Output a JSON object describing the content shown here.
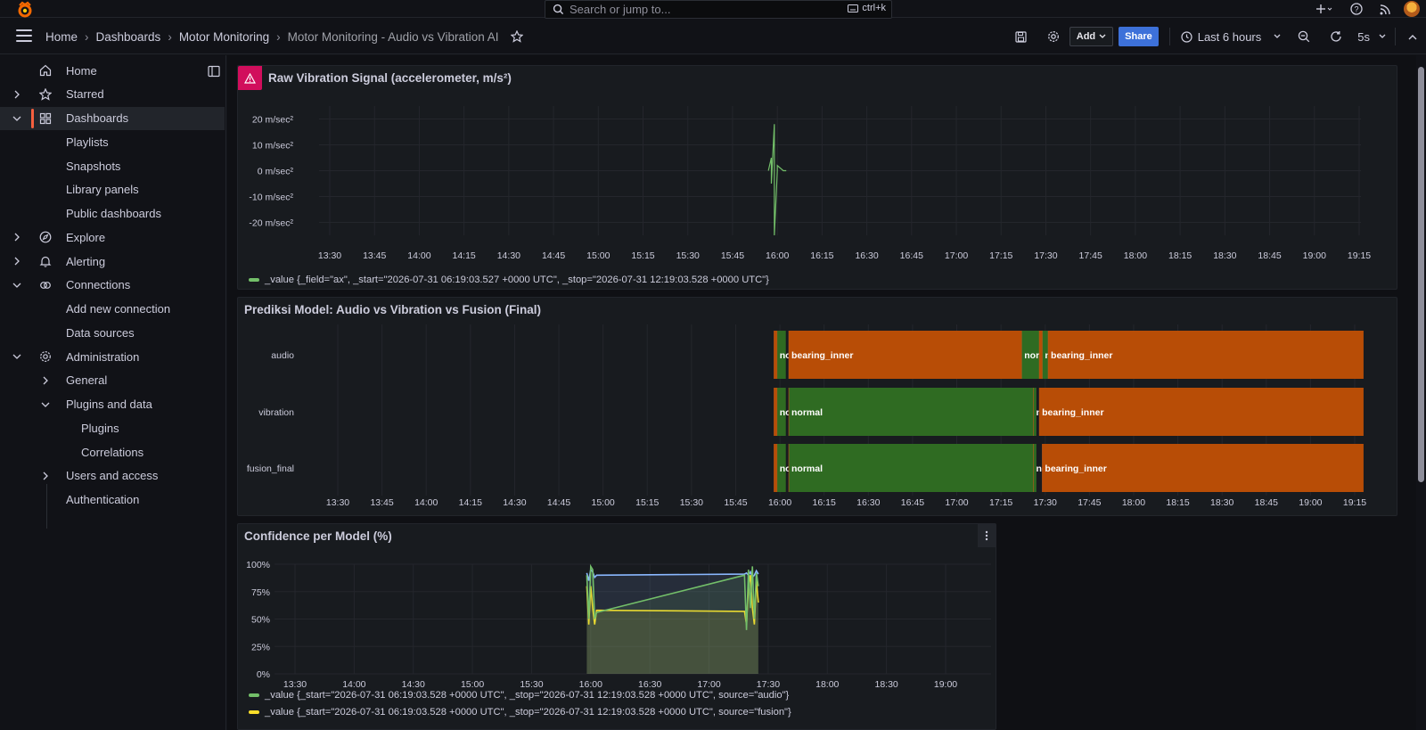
{
  "topbar": {
    "search_placeholder": "Search or jump to...",
    "search_shortcut": "ctrl+k"
  },
  "breadcrumb": [
    "Home",
    "Dashboards",
    "Motor Monitoring",
    "Motor Monitoring - Audio vs Vibration AI"
  ],
  "toolbar": {
    "add_label": "Add",
    "share_label": "Share",
    "time_range": "Last 6 hours",
    "refresh_interval": "5s"
  },
  "sidebar": {
    "items": [
      {
        "label": "Home",
        "icon": "home-icon",
        "chevron": "none",
        "indent": 0
      },
      {
        "label": "Starred",
        "icon": "star-icon",
        "chevron": "right",
        "indent": 0
      },
      {
        "label": "Dashboards",
        "icon": "apps-icon",
        "chevron": "down",
        "indent": 0,
        "active": true
      },
      {
        "label": "Playlists",
        "indent": 1
      },
      {
        "label": "Snapshots",
        "indent": 1
      },
      {
        "label": "Library panels",
        "indent": 1
      },
      {
        "label": "Public dashboards",
        "indent": 1
      },
      {
        "label": "Explore",
        "icon": "compass-icon",
        "chevron": "right",
        "indent": 0
      },
      {
        "label": "Alerting",
        "icon": "bell-icon",
        "chevron": "right",
        "indent": 0
      },
      {
        "label": "Connections",
        "icon": "link-icon",
        "chevron": "down",
        "indent": 0
      },
      {
        "label": "Add new connection",
        "indent": 1
      },
      {
        "label": "Data sources",
        "indent": 1
      },
      {
        "label": "Administration",
        "icon": "cog-icon",
        "chevron": "down",
        "indent": 0
      },
      {
        "label": "General",
        "indent": 1,
        "chevron": "right"
      },
      {
        "label": "Plugins and data",
        "indent": 1,
        "chevron": "down"
      },
      {
        "label": "Plugins",
        "indent": 2
      },
      {
        "label": "Correlations",
        "indent": 2
      },
      {
        "label": "Users and access",
        "indent": 1,
        "chevron": "right"
      },
      {
        "label": "Authentication",
        "indent": 1
      }
    ]
  },
  "panels": {
    "raw": {
      "title": "Raw Vibration Signal (accelerometer, m/s²)",
      "legend": "_value {_field=\"ax\", _start=\"2026-07-31 06:19:03.527 +0000 UTC\", _stop=\"2026-07-31 12:19:03.528 +0000 UTC\"}"
    },
    "pred": {
      "title": "Prediksi Model: Audio vs Vibration vs Fusion (Final)"
    },
    "conf": {
      "title": "Confidence per Model (%)",
      "legend": [
        "_value {_start=\"2026-07-31 06:19:03.528 +0000 UTC\", _stop=\"2026-07-31 12:19:03.528 +0000 UTC\", source=\"audio\"}",
        "_value {_start=\"2026-07-31 06:19:03.528 +0000 UTC\", _stop=\"2026-07-31 12:19:03.528 +0000 UTC\", source=\"fusion\"}"
      ]
    }
  },
  "colors": {
    "green": "#73bf69",
    "yellow": "#fade2a",
    "blue": "#8ab8ff",
    "state_green": "#2f6b22",
    "state_orange": "#b84d06",
    "alert": "#d10e5c",
    "share": "#3d71d9"
  },
  "chart_data": [
    {
      "type": "line",
      "title": "Raw Vibration Signal (accelerometer, m/s²)",
      "y_ticks": [
        "20 m/sec²",
        "10 m/sec²",
        "0 m/sec²",
        "-10 m/sec²",
        "-20 m/sec²"
      ],
      "ylim": [
        -25,
        25
      ],
      "x_ticks": [
        "13:30",
        "13:45",
        "14:00",
        "14:15",
        "14:30",
        "14:45",
        "15:00",
        "15:15",
        "15:30",
        "15:45",
        "16:00",
        "16:15",
        "16:30",
        "16:45",
        "17:00",
        "17:15",
        "17:30",
        "17:45",
        "18:00",
        "18:15",
        "18:30",
        "18:45",
        "19:00",
        "19:15"
      ],
      "series": [
        {
          "x": [
            "15:57",
            "15:58",
            "15:58",
            "15:59",
            "15:59",
            "16:00",
            "16:00",
            "16:02",
            "16:03"
          ],
          "y": [
            0,
            5,
            -5,
            18,
            -25,
            0,
            2,
            0,
            0
          ]
        }
      ],
      "grid": true,
      "legend_placement": "bottom-left"
    },
    {
      "type": "state-timeline",
      "title": "Prediksi Model: Audio vs Vibration vs Fusion (Final)",
      "rows": [
        "audio",
        "vibration",
        "fusion_final"
      ],
      "x_ticks": [
        "13:30",
        "13:45",
        "14:00",
        "14:15",
        "14:30",
        "14:45",
        "15:00",
        "15:15",
        "15:30",
        "15:45",
        "16:00",
        "16:15",
        "16:30",
        "16:45",
        "17:00",
        "17:15",
        "17:30",
        "17:45",
        "18:00",
        "18:15",
        "18:30",
        "18:45",
        "19:00",
        "19:15"
      ],
      "segments": {
        "audio": [
          {
            "state": "bearing_inner",
            "start": "15:58",
            "end": "15:59"
          },
          {
            "state": "normal",
            "start": "15:59",
            "end": "16:02",
            "label": "no"
          },
          {
            "state": "bearing_inner",
            "start": "16:03",
            "end": "17:22",
            "label": "bearing_inner"
          },
          {
            "state": "normal",
            "start": "17:22",
            "end": "17:28",
            "label": "nor"
          },
          {
            "state": "bearing_inner",
            "start": "17:28",
            "end": "17:29"
          },
          {
            "state": "normal",
            "start": "17:29",
            "end": "17:31",
            "label": "n"
          },
          {
            "state": "bearing_inner",
            "start": "17:31",
            "end": "19:18",
            "label": "bearing_inner"
          }
        ],
        "vibration": [
          {
            "state": "bearing_inner",
            "start": "15:58",
            "end": "15:59"
          },
          {
            "state": "normal",
            "start": "15:59",
            "end": "16:02",
            "label": "no"
          },
          {
            "state": "normal",
            "start": "16:03",
            "end": "17:26",
            "label": "normal"
          },
          {
            "state": "normal",
            "start": "17:26",
            "end": "17:27",
            "label": "nor"
          },
          {
            "state": "bearing_inner",
            "start": "17:28",
            "end": "19:18",
            "label": "bearing_inner"
          }
        ],
        "fusion_final": [
          {
            "state": "bearing_inner",
            "start": "15:58",
            "end": "15:59"
          },
          {
            "state": "normal",
            "start": "15:59",
            "end": "16:02",
            "label": "no"
          },
          {
            "state": "normal",
            "start": "16:03",
            "end": "17:26",
            "label": "normal"
          },
          {
            "state": "normal",
            "start": "17:26",
            "end": "17:27",
            "label": "nor"
          },
          {
            "state": "bearing_inner",
            "start": "17:29",
            "end": "19:18",
            "label": "bearing_inner"
          }
        ]
      },
      "state_colors": {
        "normal": "#2f6b22",
        "bearing_inner": "#b84d06"
      }
    },
    {
      "type": "line",
      "title": "Confidence per Model (%)",
      "y_ticks": [
        "100%",
        "75%",
        "50%",
        "25%",
        "0%"
      ],
      "ylim": [
        0,
        100
      ],
      "x_ticks": [
        "13:30",
        "14:00",
        "14:30",
        "15:00",
        "15:30",
        "16:00",
        "16:30",
        "17:00",
        "17:30",
        "18:00",
        "18:30",
        "19:00"
      ],
      "series": [
        {
          "name": "audio",
          "color": "green",
          "x": [
            "15:58",
            "15:59",
            "16:00",
            "16:01",
            "16:02",
            "16:03",
            "17:18",
            "17:19",
            "17:20",
            "17:21",
            "17:22",
            "17:23",
            "17:24",
            "17:25"
          ],
          "y": [
            90,
            50,
            98,
            95,
            50,
            56,
            90,
            40,
            95,
            60,
            98,
            50,
            92,
            80
          ]
        },
        {
          "name": "fusion",
          "color": "yellow",
          "x": [
            "15:58",
            "15:59",
            "16:00",
            "16:01",
            "16:02",
            "16:03",
            "17:18",
            "17:19",
            "17:20",
            "17:21",
            "17:22",
            "17:23",
            "17:24",
            "17:25"
          ],
          "y": [
            80,
            45,
            80,
            60,
            45,
            58,
            57,
            45,
            80,
            90,
            60,
            45,
            85,
            65
          ]
        },
        {
          "name": "",
          "color": "blue",
          "x": [
            "15:58",
            "15:59",
            "16:00",
            "16:01",
            "16:02",
            "16:03",
            "17:18",
            "17:19",
            "17:20",
            "17:21",
            "17:22",
            "17:23",
            "17:24",
            "17:25"
          ],
          "y": [
            92,
            85,
            95,
            93,
            88,
            90,
            91,
            92,
            90,
            93,
            88,
            90,
            94,
            91
          ]
        }
      ],
      "grid": true,
      "legend_placement": "bottom-left"
    }
  ]
}
